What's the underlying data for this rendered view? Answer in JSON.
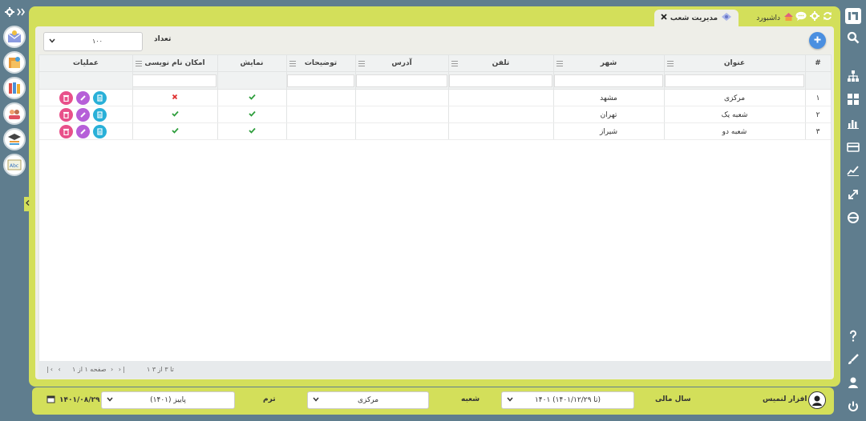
{
  "tabs": {
    "dashboard": "داشبورد",
    "branches": "مدیریت شعب"
  },
  "toolbar": {
    "count_label": "تعداد",
    "count_value": "۱۰۰"
  },
  "grid": {
    "columns": [
      "#",
      "عنوان",
      "شهر",
      "تلفن",
      "آدرس",
      "توضیحات",
      "نمایش",
      "امکان نام نویسی",
      "عملیات"
    ],
    "rows": [
      {
        "num": "۱",
        "title": "مرکزی",
        "city": "مشهد",
        "show": true,
        "enroll": false
      },
      {
        "num": "۲",
        "title": "شعبه یک",
        "city": "تهران",
        "show": true,
        "enroll": true
      },
      {
        "num": "۳",
        "title": "شعبه دو",
        "city": "شیراز",
        "show": true,
        "enroll": true
      }
    ]
  },
  "pager": {
    "range": "۱ تا ۳ از ۳",
    "page": "صفحه ۱ از ۱"
  },
  "footer": {
    "app_name": "نرم افزار لنمیس",
    "fiscal_year_label": "سال مالی",
    "fiscal_year_value": "۱۴۰۱ (۱۴۰۱/۱۲/۲۹ تا)",
    "branch_label": "شعبه",
    "branch_value": "مرکزی",
    "term_label": "ترم",
    "term_value": "پاییز (۱۴۰۱)",
    "date": "۱۴۰۱/۰۸/۲۹"
  },
  "colors": {
    "frame": "#d3df5a",
    "background": "#5f7d8e",
    "check": "#2e9e3c",
    "cross": "#e03030",
    "btn_delete": "#e8508a",
    "btn_edit": "#b65fd8",
    "btn_view": "#29b0d8",
    "add": "#4a8fe0"
  }
}
